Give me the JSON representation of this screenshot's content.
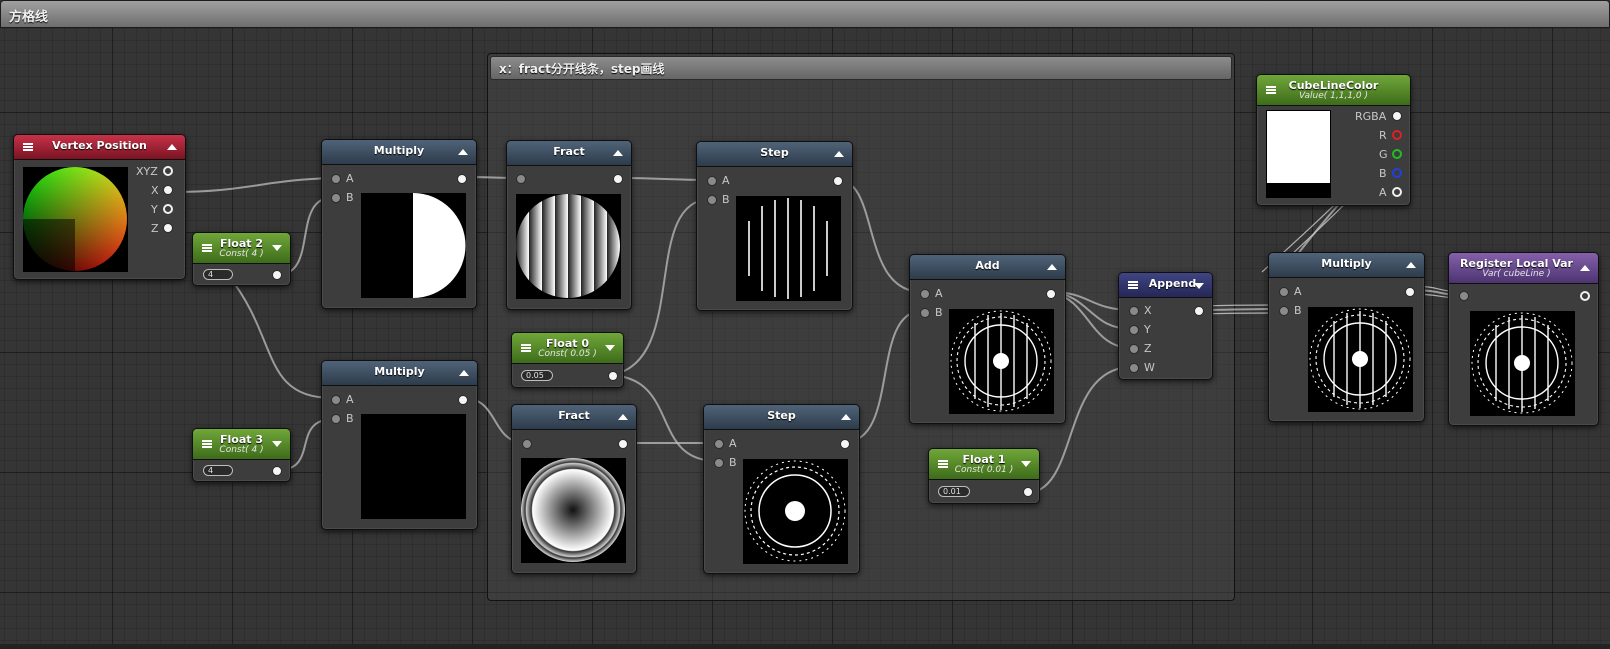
{
  "graph": {
    "title": "方格线"
  },
  "group": {
    "title": "x：fract分开线条，step画线"
  },
  "nodes": {
    "vertex_position": {
      "title": "Vertex Position",
      "ports": [
        "XYZ",
        "X",
        "Y",
        "Z"
      ]
    },
    "float2": {
      "title": "Float 2",
      "subtitle": "Const( 4 )",
      "value": "4"
    },
    "float3": {
      "title": "Float 3",
      "subtitle": "Const( 4 )",
      "value": "4"
    },
    "multiply1": {
      "title": "Multiply",
      "inputs": [
        "A",
        "B"
      ]
    },
    "multiply2": {
      "title": "Multiply",
      "inputs": [
        "A",
        "B"
      ]
    },
    "fract1": {
      "title": "Fract"
    },
    "fract2": {
      "title": "Fract"
    },
    "float0": {
      "title": "Float 0",
      "subtitle": "Const( 0.05 )",
      "value": "0.05"
    },
    "step1": {
      "title": "Step",
      "inputs": [
        "A",
        "B"
      ]
    },
    "step2": {
      "title": "Step",
      "inputs": [
        "A",
        "B"
      ]
    },
    "add": {
      "title": "Add",
      "inputs": [
        "A",
        "B"
      ]
    },
    "float1": {
      "title": "Float 1",
      "subtitle": "Const( 0.01 )",
      "value": "0.01"
    },
    "append": {
      "title": "Append",
      "inputs": [
        "X",
        "Y",
        "Z",
        "W"
      ]
    },
    "cube_line_color": {
      "title": "CubeLineColor",
      "subtitle": "Value( 1,1,1,0 )",
      "ports": [
        "RGBA",
        "R",
        "G",
        "B",
        "A"
      ]
    },
    "multiply3": {
      "title": "Multiply",
      "inputs": [
        "A",
        "B"
      ]
    },
    "register_local_var": {
      "title": "Register Local Var",
      "subtitle": "Var( cubeLine )"
    }
  },
  "colors": {
    "math_header": "#3b4d60",
    "vertex_header": "#b0263c",
    "constant_header": "#5a8e2c",
    "append_header": "#33376c",
    "register_header": "#6b4a93",
    "port_r": "#e02020",
    "port_g": "#20c020",
    "port_b": "#2040e0"
  }
}
